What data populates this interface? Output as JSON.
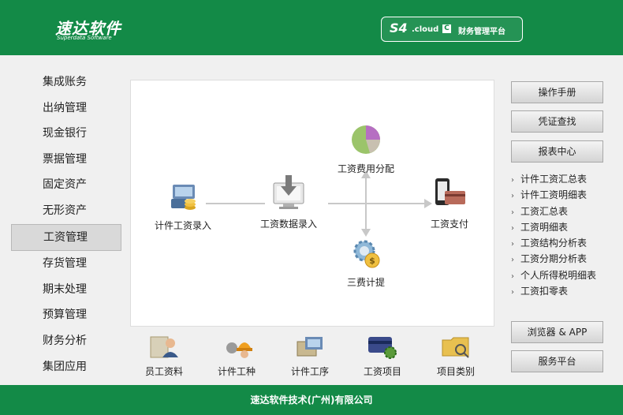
{
  "header": {
    "logo_cn": "速达软件",
    "logo_en": "Superdata Software",
    "platform_prefix": "S4",
    "platform_cloud": ".cloud",
    "platform_c": "C",
    "platform_name": "财务管理平台"
  },
  "sidebar": {
    "items": [
      {
        "label": "集成账务"
      },
      {
        "label": "出纳管理"
      },
      {
        "label": "现金银行"
      },
      {
        "label": "票据管理"
      },
      {
        "label": "固定资产"
      },
      {
        "label": "无形资产"
      },
      {
        "label": "工资管理",
        "active": true
      },
      {
        "label": "存货管理"
      },
      {
        "label": "期末处理"
      },
      {
        "label": "预算管理"
      },
      {
        "label": "财务分析"
      },
      {
        "label": "集团应用"
      }
    ]
  },
  "workflow": {
    "piece_entry": "计件工资录入",
    "data_entry": "工资数据录入",
    "allocation": "工资费用分配",
    "payment": "工资支付",
    "three_fees": "三费计提"
  },
  "bottom_icons": [
    {
      "label": "员工资料",
      "icon": "employee-icon"
    },
    {
      "label": "计件工种",
      "icon": "worker-icon"
    },
    {
      "label": "计件工序",
      "icon": "process-icon"
    },
    {
      "label": "工资项目",
      "icon": "card-gear-icon"
    },
    {
      "label": "项目类别",
      "icon": "folder-icon"
    }
  ],
  "right": {
    "manual": "操作手册",
    "voucher": "凭证查找",
    "reports": "报表中心",
    "report_links": [
      "计件工资汇总表",
      "计件工资明细表",
      "工资汇总表",
      "工资明细表",
      "工资结构分析表",
      "工资分期分析表",
      "个人所得税明细表",
      "工资扣零表"
    ],
    "browser_app": "浏览器 & APP",
    "service": "服务平台"
  },
  "footer": {
    "company": "速达软件技术(广州)有限公司"
  },
  "colors": {
    "brand_green": "#138a47"
  }
}
